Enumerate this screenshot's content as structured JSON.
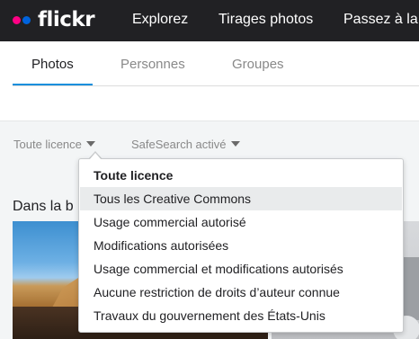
{
  "header": {
    "logo_text": "flickr",
    "nav": [
      "Explorez",
      "Tirages photos",
      "Passez à la v"
    ]
  },
  "tabs": [
    {
      "label": "Photos",
      "active": true
    },
    {
      "label": "Personnes",
      "active": false
    },
    {
      "label": "Groupes",
      "active": false
    }
  ],
  "filters": {
    "license_label": "Toute licence",
    "safesearch_label": "SafeSearch activé"
  },
  "section": {
    "title": "Dans la b"
  },
  "license_menu": {
    "items": [
      {
        "label": "Toute licence",
        "selected": true
      },
      {
        "label": "Tous les Creative Commons",
        "highlighted": true
      },
      {
        "label": "Usage commercial autorisé"
      },
      {
        "label": "Modifications autorisées"
      },
      {
        "label": "Usage commercial et modifications autorisés"
      },
      {
        "label": "Aucune restriction de droits d’auteur connue"
      },
      {
        "label": "Travaux du gouvernement des États-Unis"
      }
    ]
  },
  "colors": {
    "topbar": "#212124",
    "accent_blue": "#128fdc",
    "logo_pink": "#ff0084",
    "logo_blue": "#0063dc"
  }
}
